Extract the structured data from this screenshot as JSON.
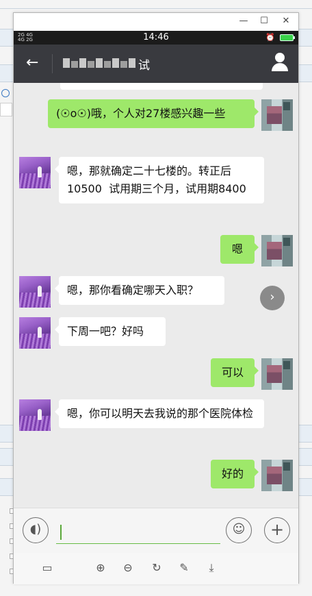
{
  "status_bar": {
    "signal_text": "2G 4G\n4G 2G",
    "time": "14:46",
    "alarm_icon": "alarm-icon",
    "battery_icon": "battery-charging-icon"
  },
  "window_controls": {
    "minimize": "—",
    "maximize": "☐",
    "close": "✕"
  },
  "app_bar": {
    "back_icon": "←",
    "title_suffix": "试",
    "profile_icon": "person-icon"
  },
  "messages": [
    {
      "side": "out",
      "text": "(☉o☉)哦，个人对27楼感兴趣一些"
    },
    {
      "side": "in",
      "text": "嗯，那就确定二十七楼的。转正后10500  试用期三个月，试用期8400"
    },
    {
      "side": "out",
      "text": "嗯"
    },
    {
      "side": "in",
      "text": "嗯，那你看确定哪天入职？"
    },
    {
      "side": "in",
      "text": "下周一吧？好吗"
    },
    {
      "side": "out",
      "text": "可以"
    },
    {
      "side": "in",
      "text": "嗯，你可以明天去我说的那个医院体检"
    },
    {
      "side": "out",
      "text": "好的"
    }
  ],
  "input_bar": {
    "voice_icon": "voice-icon",
    "value": "",
    "emoji_icon": "emoji-icon",
    "add_icon": "plus-icon"
  },
  "toolbar": {
    "items": [
      "screen-icon",
      "zoom-in-icon",
      "zoom-out-icon",
      "rotate-icon",
      "edit-icon",
      "download-icon"
    ]
  },
  "colors": {
    "app_bar": "#393a3f",
    "chat_bg": "#ebebeb",
    "outgoing_bubble": "#9ee86a",
    "incoming_bubble": "#ffffff"
  }
}
